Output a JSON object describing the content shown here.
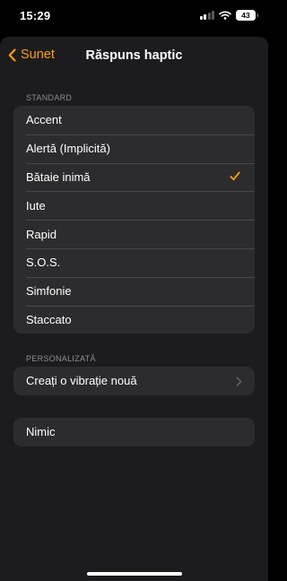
{
  "status": {
    "time": "15:29",
    "battery": "43"
  },
  "nav": {
    "back_label": "Sunet",
    "title": "Răspuns haptic"
  },
  "standard": {
    "header": "STANDARD",
    "items": [
      {
        "label": "Accent"
      },
      {
        "label": "Alertă (Implicită)"
      },
      {
        "label": "Bătaie inimă",
        "selected": true
      },
      {
        "label": "Iute"
      },
      {
        "label": "Rapid"
      },
      {
        "label": "S.O.S."
      },
      {
        "label": "Simfonie"
      },
      {
        "label": "Staccato"
      }
    ]
  },
  "custom": {
    "header": "PERSONALIZATĂ",
    "create_label": "Creați o vibrație nouă"
  },
  "none": {
    "label": "Nimic"
  },
  "colors": {
    "accent": "#ff9f0a",
    "background": "#000000",
    "sheet": "#1c1c1e",
    "cell": "#2c2c2e",
    "secondary_text": "#8e8e93"
  }
}
